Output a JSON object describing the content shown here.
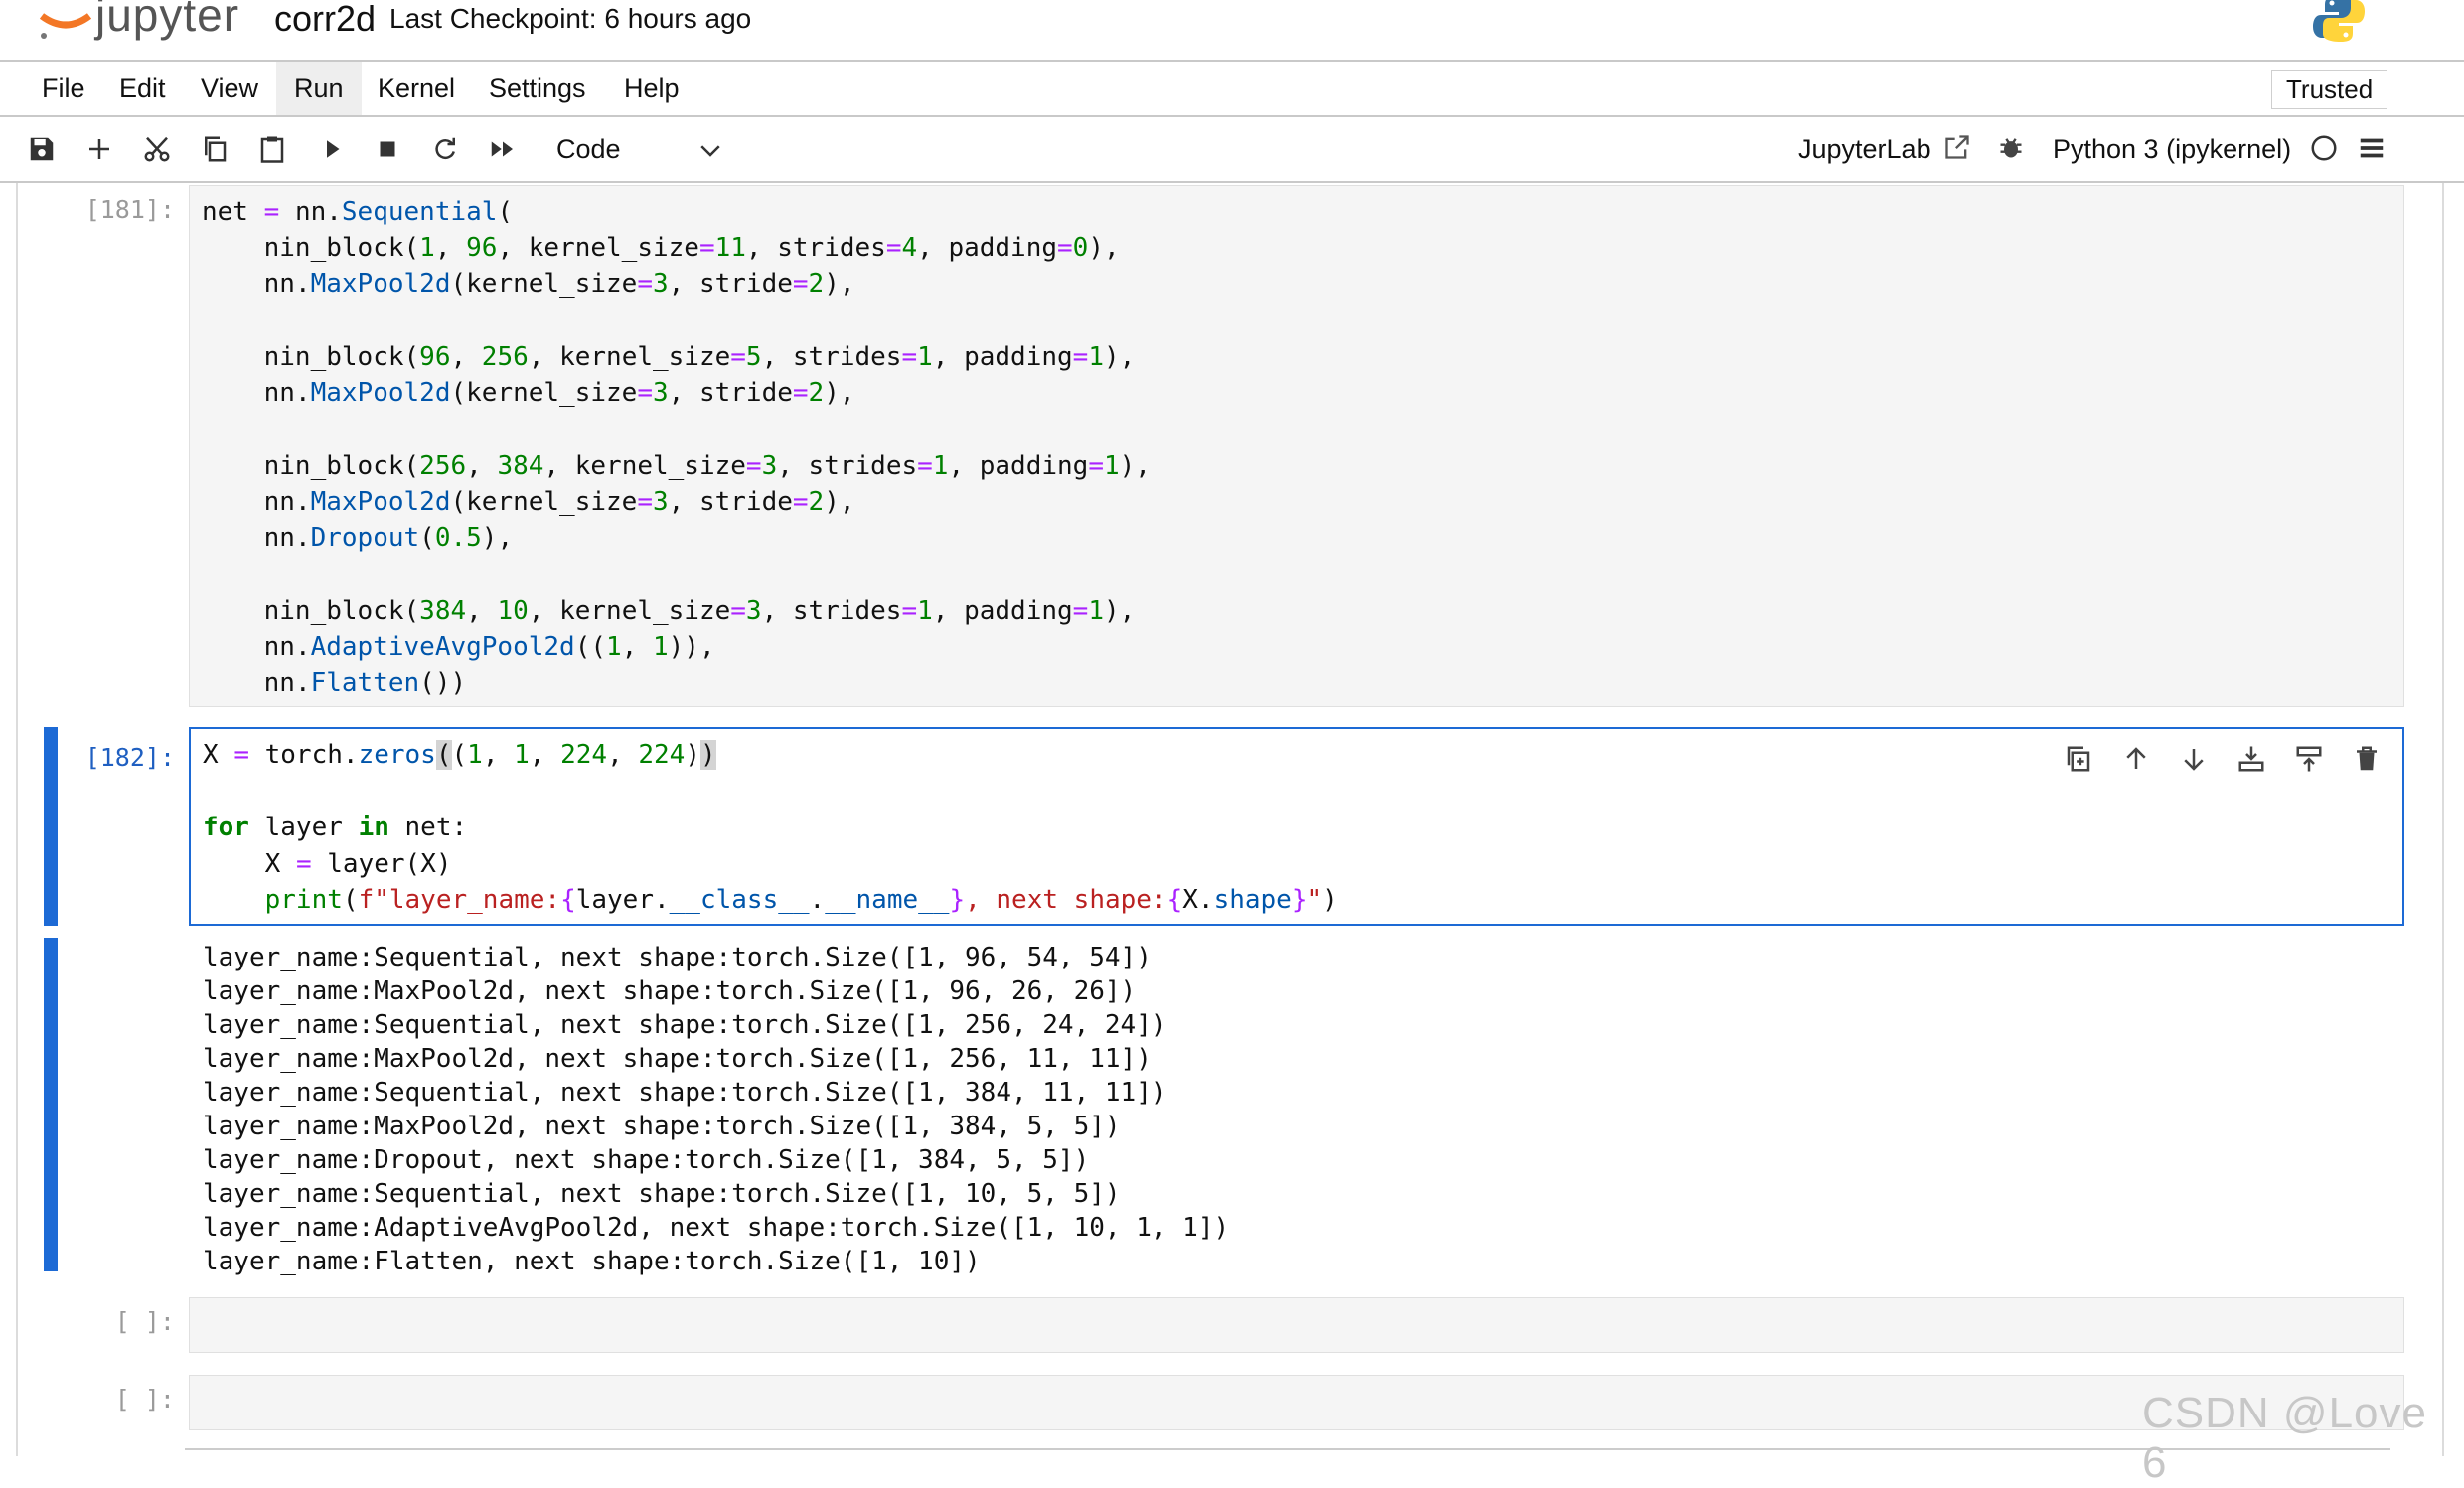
{
  "header": {
    "logo_text": "jupyter",
    "notebook_name": "corr2d",
    "checkpoint": "Last Checkpoint: 6 hours ago",
    "logo_icon": "jupyter-logo-icon",
    "kernel_logo_icon": "python-logo-icon"
  },
  "menu": {
    "items": [
      "File",
      "Edit",
      "View",
      "Run",
      "Kernel",
      "Settings",
      "Help"
    ],
    "active": "Run",
    "trusted": "Trusted"
  },
  "toolbar": {
    "icons": [
      "save-icon",
      "add-cell-icon",
      "cut-icon",
      "copy-icon",
      "paste-icon",
      "run-icon",
      "stop-icon",
      "restart-icon",
      "fast-forward-icon"
    ],
    "cell_type": "Code",
    "jupyterlab_link": "JupyterLab",
    "kernel_name": "Python 3 (ipykernel)"
  },
  "cells": {
    "c181": {
      "prompt": "[181]:"
    },
    "c182": {
      "prompt": "[182]:",
      "output": [
        "layer_name:Sequential, next shape:torch.Size([1, 96, 54, 54])",
        "layer_name:MaxPool2d, next shape:torch.Size([1, 96, 26, 26])",
        "layer_name:Sequential, next shape:torch.Size([1, 256, 24, 24])",
        "layer_name:MaxPool2d, next shape:torch.Size([1, 256, 11, 11])",
        "layer_name:Sequential, next shape:torch.Size([1, 384, 11, 11])",
        "layer_name:MaxPool2d, next shape:torch.Size([1, 384, 5, 5])",
        "layer_name:Dropout, next shape:torch.Size([1, 384, 5, 5])",
        "layer_name:Sequential, next shape:torch.Size([1, 10, 5, 5])",
        "layer_name:AdaptiveAvgPool2d, next shape:torch.Size([1, 10, 1, 1])",
        "layer_name:Flatten, next shape:torch.Size([1, 10])"
      ]
    },
    "empty1": {
      "prompt": "[ ]:"
    },
    "empty2": {
      "prompt": "[ ]:"
    }
  },
  "code_tokens": {
    "t1": "net",
    "t2": "=",
    "t3": "nn",
    "t4": "Sequential",
    "t5": "nin_block",
    "t6": "1",
    "t7": "96",
    "t8": "kernel_size",
    "t9": "11",
    "t10": "strides",
    "t11": "4",
    "t12": "padding",
    "t13": "0",
    "t14": "MaxPool2d",
    "t15": "3",
    "t16": "stride",
    "t17": "2",
    "t18": "256",
    "t19": "5",
    "t20": "384",
    "t21": "Dropout",
    "t22": "0.5",
    "t23": "10",
    "t24": "AdaptiveAvgPool2d",
    "t25": "Flatten",
    "t26": "X",
    "t27": "torch",
    "t28": "zeros",
    "t29": "224",
    "t30": "for",
    "t31": "layer",
    "t32": "in",
    "t33": "print",
    "t34": "f\"layer_name:",
    "t35": "__class__",
    "t36": "__name__",
    "t37": ", next shape:",
    "t38": "shape",
    "t39": "\""
  },
  "cell_tool_icons": [
    "duplicate-icon",
    "move-up-icon",
    "move-down-icon",
    "insert-above-icon",
    "insert-below-icon",
    "delete-icon"
  ],
  "watermark": "CSDN @Love 6"
}
